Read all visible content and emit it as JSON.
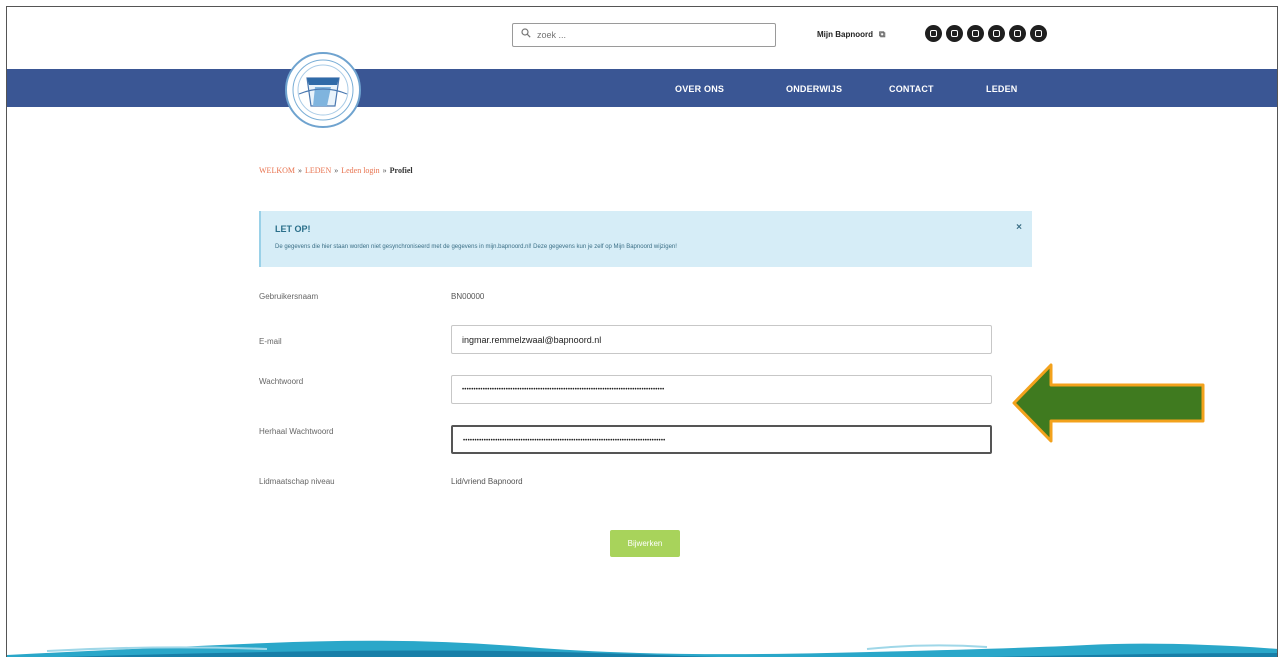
{
  "header": {
    "search": {
      "placeholder": "zoek ...",
      "icon": "search-icon"
    },
    "mijn_link": "Mijn Bapnoord",
    "socials": [
      "facebook-icon",
      "instagram-icon",
      "youtube-icon",
      "linkedin-icon",
      "twitter-icon",
      "mail-icon"
    ]
  },
  "nav": {
    "items": [
      "OVER ONS",
      "ONDERWIJS",
      "CONTACT",
      "LEDEN"
    ]
  },
  "breadcrumb": {
    "items": [
      "WELKOM",
      "LEDEN",
      "Leden login"
    ],
    "separator": "»",
    "current": "Profiel"
  },
  "alert": {
    "title": "LET OP!",
    "body": "De gegevens die hier staan worden niet gesynchroniseerd met de gegevens in mijn.bapnoord.nl! Deze gegevens kun je zelf op Mijn Bapnoord wijzigen!",
    "close": "×"
  },
  "form": {
    "username_label": "Gebruikersnaam",
    "username_value": "BN00000",
    "email_label": "E-mail",
    "email_value": "ingmar.remmelzwaal@bapnoord.nl",
    "password_label": "Wachtwoord",
    "password_value": "••••••••••••••••••••••••••••••••••••••••••••••••••••••••••••••••••••••••••••••••••••••••",
    "repeat_label": "Herhaal Wachtwoord",
    "repeat_value": "••••••••••••••••••••••••••••••••••••••••••••••••••••••••••••••••••••••••••••••••••••••••",
    "membership_label": "Lidmaatschap niveau",
    "membership_value": "Lid/vriend Bapnoord",
    "submit_label": "Bijwerken"
  },
  "colors": {
    "nav": "#3a5694",
    "accent_link": "#e8734f",
    "alert_bg": "#d6edf7",
    "button": "#a8d35b",
    "arrow_fill": "#3f7a1f",
    "arrow_border": "#f3a21c"
  }
}
